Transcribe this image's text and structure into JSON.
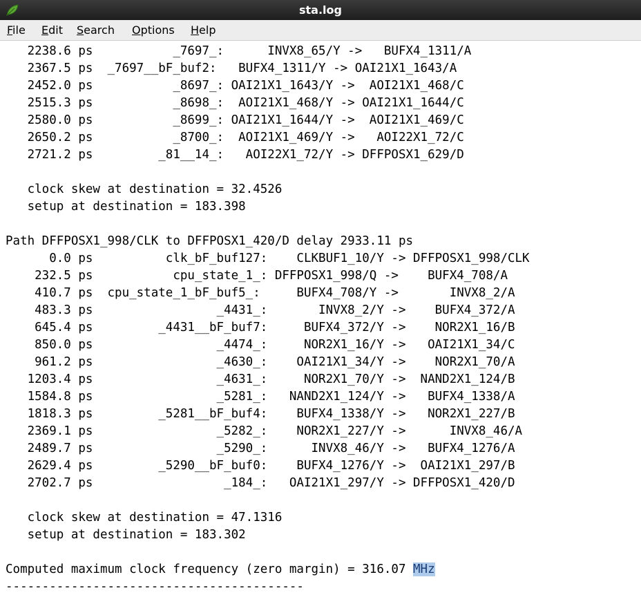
{
  "window": {
    "title": "sta.log",
    "app_icon": "leaf-icon"
  },
  "menu": [
    {
      "mnemonic": "F",
      "rest": "ile"
    },
    {
      "mnemonic": "E",
      "rest": "dit"
    },
    {
      "mnemonic": "S",
      "rest": "earch"
    },
    {
      "mnemonic": "O",
      "rest": "ptions"
    },
    {
      "mnemonic": "H",
      "rest": "elp"
    }
  ],
  "log": {
    "lines": [
      "   2238.6 ps           _7697_:      INVX8_65/Y ->   BUFX4_1311/A",
      "   2367.5 ps  _7697__bF_buf2:   BUFX4_1311/Y -> OAI21X1_1643/A",
      "   2452.0 ps           _8697_: OAI21X1_1643/Y ->  AOI21X1_468/C",
      "   2515.3 ps           _8698_:  AOI21X1_468/Y -> OAI21X1_1644/C",
      "   2580.0 ps           _8699_: OAI21X1_1644/Y ->  AOI21X1_469/C",
      "   2650.2 ps           _8700_:  AOI21X1_469/Y ->   AOI22X1_72/C",
      "   2721.2 ps         _81__14_:   AOI22X1_72/Y -> DFFPOSX1_629/D",
      "",
      "   clock skew at destination = 32.4526",
      "   setup at destination = 183.398",
      "",
      "Path DFFPOSX1_998/CLK to DFFPOSX1_420/D delay 2933.11 ps",
      "      0.0 ps          clk_bF_buf127:    CLKBUF1_10/Y -> DFFPOSX1_998/CLK",
      "    232.5 ps           cpu_state_1_: DFFPOSX1_998/Q ->    BUFX4_708/A",
      "    410.7 ps  cpu_state_1_bF_buf5_:     BUFX4_708/Y ->       INVX8_2/A",
      "    483.3 ps                 _4431_:       INVX8_2/Y ->    BUFX4_372/A",
      "    645.4 ps         _4431__bF_buf7:     BUFX4_372/Y ->    NOR2X1_16/B",
      "    850.0 ps                 _4474_:     NOR2X1_16/Y ->   OAI21X1_34/C",
      "    961.2 ps                 _4630_:    OAI21X1_34/Y ->    NOR2X1_70/A",
      "   1203.4 ps                 _4631_:     NOR2X1_70/Y ->  NAND2X1_124/B",
      "   1584.8 ps                 _5281_:   NAND2X1_124/Y ->   BUFX4_1338/A",
      "   1818.3 ps         _5281__bF_buf4:    BUFX4_1338/Y ->   NOR2X1_227/B",
      "   2369.1 ps                 _5282_:    NOR2X1_227/Y ->      INVX8_46/A",
      "   2489.7 ps                 _5290_:      INVX8_46/Y ->   BUFX4_1276/A",
      "   2629.4 ps         _5290__bF_buf0:    BUFX4_1276/Y ->  OAI21X1_297/B",
      "   2702.7 ps                  _184_:   OAI21X1_297/Y -> DFFPOSX1_420/D",
      "",
      "   clock skew at destination = 47.1316",
      "   setup at destination = 183.302",
      ""
    ],
    "result_prefix": "Computed maximum clock frequency (zero margin) = 316.07 ",
    "result_unit_selected": "MHz",
    "separator": "-----------------------------------------"
  }
}
